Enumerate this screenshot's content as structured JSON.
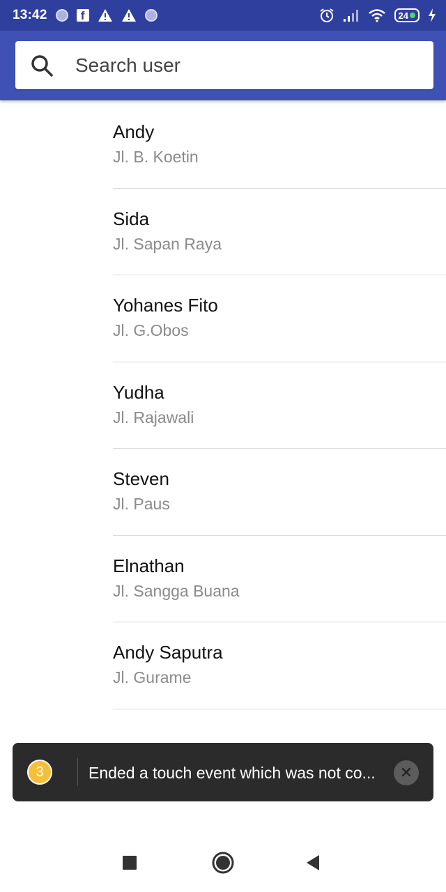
{
  "status_bar": {
    "time": "13:42",
    "battery": "24",
    "icons": [
      "dot-icon",
      "facebook-icon",
      "warning-icon",
      "warning-icon",
      "dot-icon",
      "alarm-icon",
      "signal-icon",
      "wifi-icon",
      "battery-icon",
      "charging-icon"
    ]
  },
  "search": {
    "placeholder": "Search user",
    "icon": "search-icon"
  },
  "users": [
    {
      "name": "Andy",
      "address": "Jl. B. Koetin"
    },
    {
      "name": "Sida",
      "address": "Jl. Sapan Raya"
    },
    {
      "name": "Yohanes Fito",
      "address": "Jl. G.Obos"
    },
    {
      "name": "Yudha",
      "address": "Jl. Rajawali"
    },
    {
      "name": "Steven",
      "address": "Jl. Paus"
    },
    {
      "name": "Elnathan",
      "address": "Jl. Sangga Buana"
    },
    {
      "name": "Andy Saputra",
      "address": "Jl. Gurame"
    }
  ],
  "toast": {
    "count": "3",
    "message": "Ended a touch event which was not co..."
  },
  "colors": {
    "status_bar": "#2f3f9e",
    "header": "#3f51b5",
    "toast_bg": "#2b2b2b",
    "badge": "#f4bf3a"
  }
}
